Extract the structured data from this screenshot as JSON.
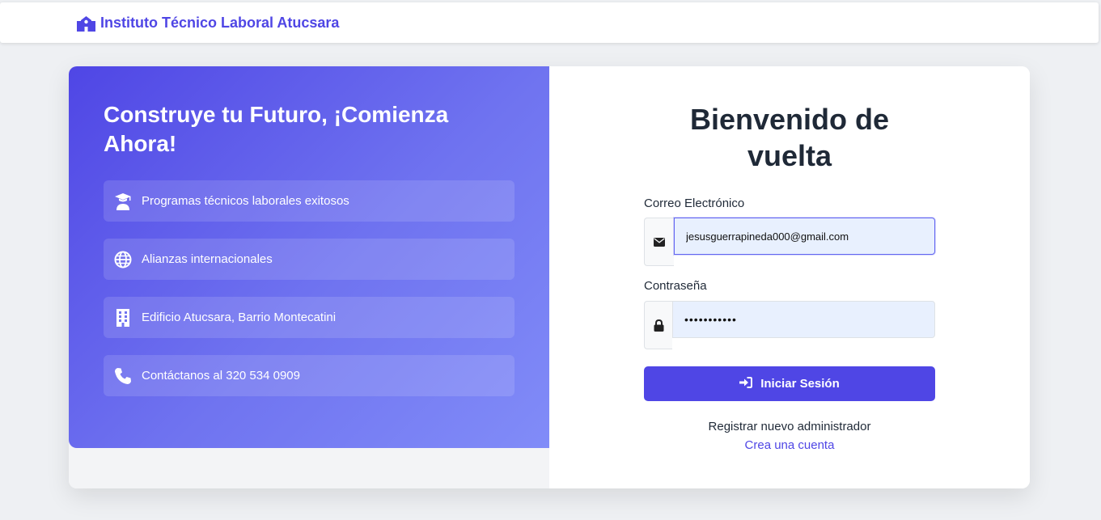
{
  "navbar": {
    "brand": "Instituto Técnico Laboral Atucsara",
    "brand_icon": "school-icon",
    "accent_color": "#4f46e5"
  },
  "left": {
    "headline": "Construye tu Futuro, ¡Comienza Ahora!",
    "features": [
      {
        "icon": "graduate-icon",
        "text": "Programas técnicos laborales exitosos"
      },
      {
        "icon": "globe-icon",
        "text": "Alianzas internacionales"
      },
      {
        "icon": "building-icon",
        "text": "Edificio Atucsara, Barrio Montecatini"
      },
      {
        "icon": "phone-icon",
        "text": "Contáctanos al 320 534 0909"
      }
    ]
  },
  "form": {
    "title_line1": "Bienvenido de",
    "title_line2": "vuelta",
    "email_label": "Correo Electrónico",
    "email_value": "jesusguerrapineda000@gmail.com",
    "email_icon": "envelope-icon",
    "password_label": "Contraseña",
    "password_value": "•••••••••••",
    "password_icon": "lock-icon",
    "login_button": "Iniciar Sesión",
    "login_icon": "sign-in-icon",
    "register_text": "Registrar nuevo administrador",
    "register_link": "Crea una cuenta"
  }
}
